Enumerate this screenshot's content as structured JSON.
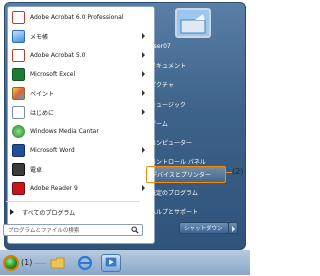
{
  "programs": [
    {
      "label": "Adobe Acrobat 6.0 Professional",
      "icon": "acrobat-icon",
      "arrow": false
    },
    {
      "label": "メモ帳",
      "icon": "notepad-icon",
      "arrow": true
    },
    {
      "label": "Adobe Acrobat 5.0",
      "icon": "acrobat-icon",
      "arrow": true
    },
    {
      "label": "Microsoft Excel",
      "icon": "excel-icon",
      "arrow": true
    },
    {
      "label": "ペイント",
      "icon": "paint-icon",
      "arrow": true
    },
    {
      "label": "はじめに",
      "icon": "getting-started-icon",
      "arrow": true
    },
    {
      "label": "Windows Media Cantar",
      "icon": "media-center-icon",
      "arrow": false
    },
    {
      "label": "Microsoft Word",
      "icon": "word-icon",
      "arrow": true
    },
    {
      "label": "電卓",
      "icon": "calculator-icon",
      "arrow": false
    },
    {
      "label": "Adobe Reader 9",
      "icon": "adobe-reader-icon",
      "arrow": true
    }
  ],
  "all_programs": "すべてのプログラム",
  "search_placeholder": "プログラムとファイルの検索",
  "right_items": [
    {
      "label": "user07"
    },
    {
      "label": "ドキュメント"
    },
    {
      "label": "ピクチャ"
    },
    {
      "label": "ミュージック"
    },
    {
      "label": "ゲーム"
    },
    {
      "label": "コンピューター"
    },
    {
      "label": "コントロール パネル"
    },
    {
      "label": "デバイスとプリンター",
      "highlight": true
    },
    {
      "label": "既定のプログラム"
    },
    {
      "label": "ヘルプとサポート"
    }
  ],
  "shutdown_label": "シャットダウン",
  "callouts": {
    "one": "(1)",
    "two": "(2)"
  },
  "colors": {
    "highlight_border": "#ff8a00",
    "menu_bg": "#3d6289"
  }
}
